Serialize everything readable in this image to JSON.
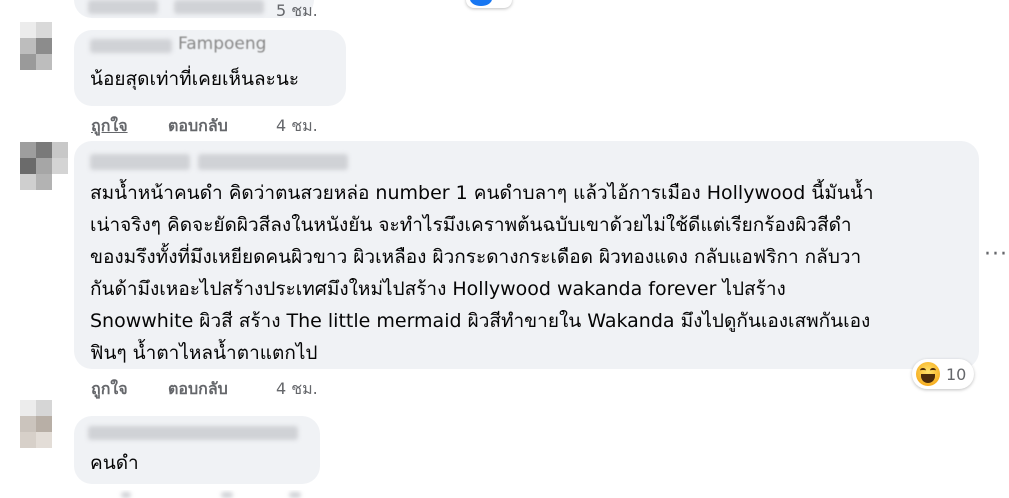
{
  "comments": [
    {
      "time": "5 ชม."
    },
    {
      "name_fragment": "Fampoeng",
      "text_lines": [
        "น้อยสุดเท่าที่เคยเห็นละนะ"
      ],
      "like": "ถูกใจ",
      "reply": "ตอบกลับ",
      "time": "4 ชม."
    },
    {
      "text_lines": [
        "สมน้ำหน้าคนดำ คิดว่าตนสวยหล่อ number 1 คนดำบลาๆ แล้วไอ้การเมือง Hollywood นี้มันน้ำ",
        "เน่าจริงๆ คิดจะยัดผิวสีลงในหนังยัน จะทำไรมึงเคราพต้นฉบับเขาด้วยไม่ใช้ดีแต่เรียกร้องผิวสีดำ",
        "ของมรึงทั้งที่มึงเหยียดคนผิวขาว ผิวเหลือง ผิวกระดางกระเดือด ผิวทองแดง กลับแอฟริกา กลับวา",
        "กันด้ามึงเหอะไปสร้างประเทศมึงใหม่ไปสร้าง Hollywood wakanda forever ไปสร้าง",
        "Snowwhite ผิวสี สร้าง The little mermaid ผิวสีทำขายใน Wakanda มึงไปดูกันเองเสพกันเอง",
        "ฟินๆ น้ำตาไหลน้ำตาแตกไป"
      ],
      "reaction_count": "10",
      "reaction_icon": "haha-icon",
      "more_icon": "more-options-icon",
      "like": "ถูกใจ",
      "reply": "ตอบกลับ",
      "time": "4 ชม."
    },
    {
      "text_lines": [
        "คนดำ"
      ]
    }
  ],
  "colors": {
    "bubble": "#f0f2f5",
    "text": "#050505",
    "meta": "#65676b"
  }
}
